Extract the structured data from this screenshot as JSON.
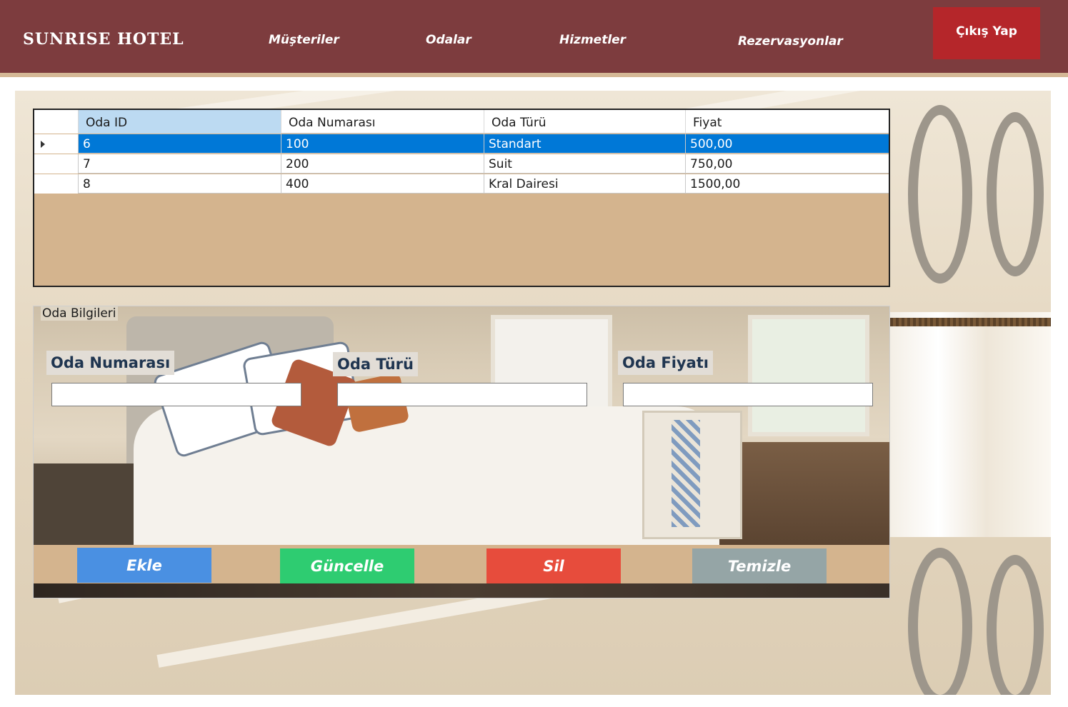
{
  "header": {
    "brand": "SUNRISE HOTEL",
    "nav": [
      {
        "label": "Müşteriler"
      },
      {
        "label": "Odalar"
      },
      {
        "label": "Hizmetler"
      },
      {
        "label": "Rezervasyonlar"
      }
    ],
    "logout_label": "Çıkış Yap",
    "colors": {
      "bar": "#7d3c3e",
      "logout": "#b5262a",
      "strip": "#d4b896"
    }
  },
  "grid": {
    "columns": [
      "Oda ID",
      "Oda Numarası",
      "Oda Türü",
      "Fiyat"
    ],
    "rows": [
      {
        "id": "6",
        "numara": "100",
        "tur": "Standart",
        "fiyat": "500,00",
        "selected": true
      },
      {
        "id": "7",
        "numara": "200",
        "tur": "Suit",
        "fiyat": "750,00",
        "selected": false
      },
      {
        "id": "8",
        "numara": "400",
        "tur": "Kral Dairesi",
        "fiyat": "1500,00",
        "selected": false
      }
    ],
    "selection_color": "#0078d7"
  },
  "form": {
    "legend": "Oda Bilgileri",
    "fields": [
      {
        "label": "Oda Numarası",
        "value": ""
      },
      {
        "label": "Oda Türü",
        "value": ""
      },
      {
        "label": "Oda Fiyatı",
        "value": ""
      }
    ]
  },
  "actions": [
    {
      "label": "Ekle",
      "color": "#4a90e2"
    },
    {
      "label": "Güncelle",
      "color": "#2ecc71"
    },
    {
      "label": "Sil",
      "color": "#e74c3c"
    },
    {
      "label": "Temizle",
      "color": "#95a5a6"
    }
  ]
}
